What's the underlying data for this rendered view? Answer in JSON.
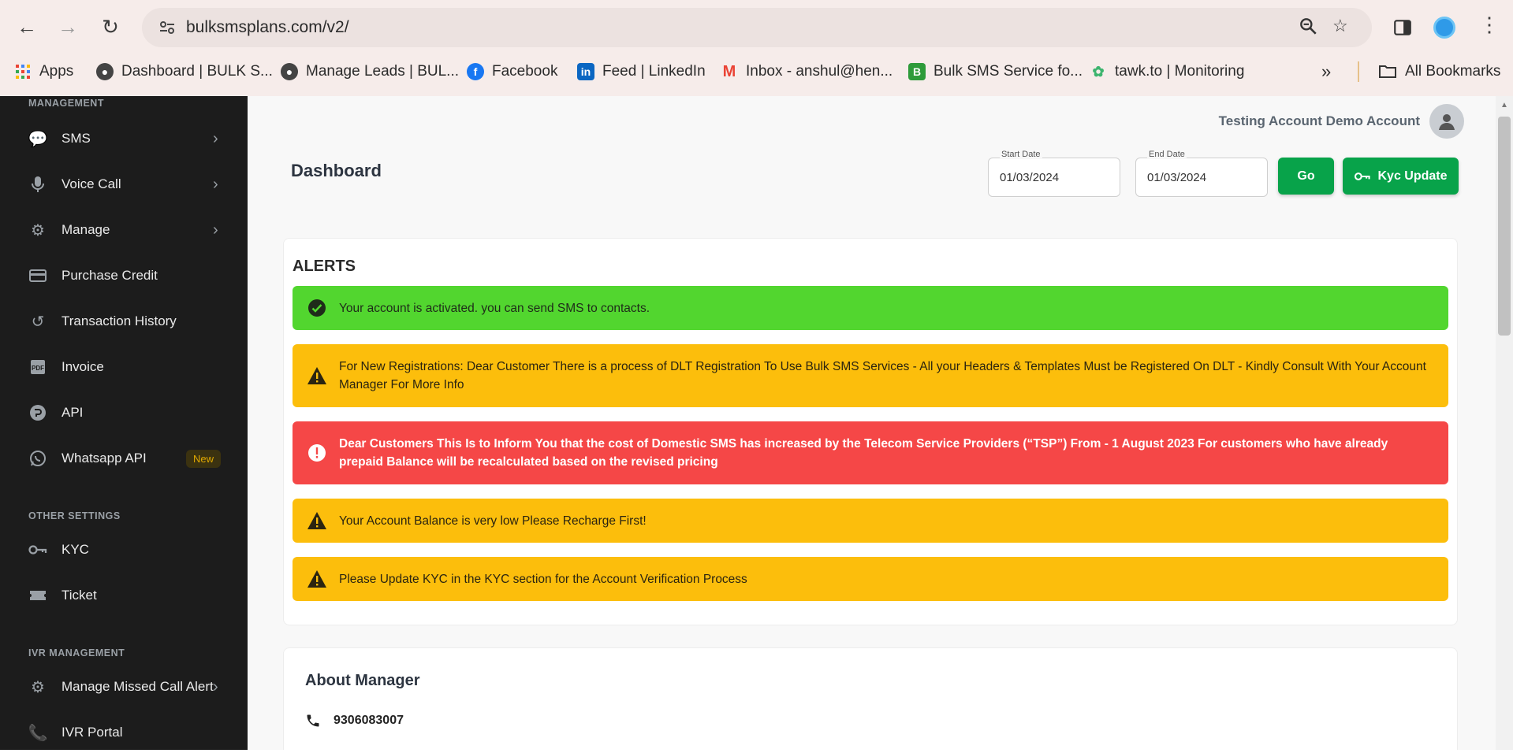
{
  "browser": {
    "url": "bulksmsplans.com/v2/",
    "bookmarks": [
      {
        "label": "Apps",
        "icon": "apps-grid-icon"
      },
      {
        "label": "Dashboard | BULK S...",
        "icon": "globe-icon"
      },
      {
        "label": "Manage Leads | BUL...",
        "icon": "globe-icon"
      },
      {
        "label": "Facebook",
        "icon": "facebook-icon"
      },
      {
        "label": "Feed | LinkedIn",
        "icon": "linkedin-icon"
      },
      {
        "label": "Inbox - anshul@hen...",
        "icon": "gmail-icon"
      },
      {
        "label": "Bulk SMS Service fo...",
        "icon": "bulk-sms-icon"
      },
      {
        "label": "tawk.to | Monitoring",
        "icon": "tawkto-icon"
      }
    ],
    "all_bookmarks": "All Bookmarks"
  },
  "sidebar": {
    "section_management": "MANAGEMENT",
    "management_items": [
      {
        "label": "SMS",
        "icon": "chat-bubbles-icon",
        "has_submenu": true
      },
      {
        "label": "Voice Call",
        "icon": "microphone-icon",
        "has_submenu": true
      },
      {
        "label": "Manage",
        "icon": "gear-icon",
        "has_submenu": true
      },
      {
        "label": "Purchase Credit",
        "icon": "credit-card-icon"
      },
      {
        "label": "Transaction History",
        "icon": "history-icon"
      },
      {
        "label": "Invoice",
        "icon": "pdf-icon"
      },
      {
        "label": "API",
        "icon": "api-icon"
      },
      {
        "label": "Whatsapp API",
        "icon": "whatsapp-icon",
        "badge": "New"
      }
    ],
    "section_other": "OTHER SETTINGS",
    "other_items": [
      {
        "label": "KYC",
        "icon": "key-icon"
      },
      {
        "label": "Ticket",
        "icon": "ticket-icon"
      }
    ],
    "section_ivr": "IVR MANAGEMENT",
    "ivr_items": [
      {
        "label": "Manage Missed Call Alert",
        "icon": "gear-icon",
        "has_submenu": true
      },
      {
        "label": "IVR Portal",
        "icon": "phone-icon"
      }
    ]
  },
  "header": {
    "user_name": "Testing Account Demo Account",
    "page_title": "Dashboard",
    "start_date_label": "Start Date",
    "start_date": "01/03/2024",
    "end_date_label": "End Date",
    "end_date": "01/03/2024",
    "go_label": "Go",
    "kyc_label": "Kyc Update"
  },
  "alerts": {
    "heading": "ALERTS",
    "items": [
      {
        "type": "success",
        "text": "Your account is activated. you can send SMS to contacts."
      },
      {
        "type": "warning",
        "text": "For New Registrations: Dear Customer There is a process of DLT Registration To Use Bulk SMS Services - All your Headers & Templates Must be Registered On DLT - Kindly Consult With Your Account Manager For More Info"
      },
      {
        "type": "danger",
        "text": "Dear Customers This Is to Inform You that the cost of Domestic SMS has increased by the Telecom Service Providers (“TSP”) From - 1 August 2023 For customers who have already prepaid Balance will be recalculated based on the revised pricing"
      },
      {
        "type": "warning",
        "text": "Your Account Balance is very low Please Recharge First!"
      },
      {
        "type": "warning",
        "text": "Please Update KYC in the KYC section for the Account Verification Process"
      }
    ]
  },
  "manager": {
    "heading": "About Manager",
    "phone": "9306083007"
  },
  "colors": {
    "sidebar_bg": "#1c1c1c",
    "primary_green": "#08a34a",
    "alert_success": "#52d62f",
    "alert_warning": "#fcbe0c",
    "alert_danger": "#f54747"
  }
}
